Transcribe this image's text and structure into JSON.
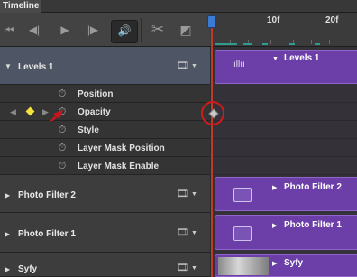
{
  "panel": {
    "title": "Timeline"
  },
  "toolbar": {
    "first_frame_icon": "⏮",
    "prev_frame_icon": "◀|",
    "play_icon": "▶",
    "next_frame_icon": "|▶",
    "audio_icon": "🔊",
    "split_icon": "✂",
    "transition_icon": "◩"
  },
  "ruler": {
    "labels": [
      "10f",
      "20f"
    ]
  },
  "layers": [
    {
      "name": "Levels 1",
      "expanded": true,
      "clip_label": "Levels 1"
    },
    {
      "name": "Photo Filter 2",
      "expanded": false,
      "clip_label": "Photo Filter 2"
    },
    {
      "name": "Photo Filter 1",
      "expanded": false,
      "clip_label": "Photo Filter 1"
    },
    {
      "name": "Syfy",
      "expanded": false,
      "clip_label": "Syfy"
    }
  ],
  "properties": [
    "Position",
    "Opacity",
    "Style",
    "Layer Mask Position",
    "Layer Mask Enable"
  ],
  "colors": {
    "clip": "#6c3fa8",
    "playhead": "#c0392b",
    "keyframe_marker": "#f3e23a",
    "highlight_circle": "#d21b1b"
  }
}
